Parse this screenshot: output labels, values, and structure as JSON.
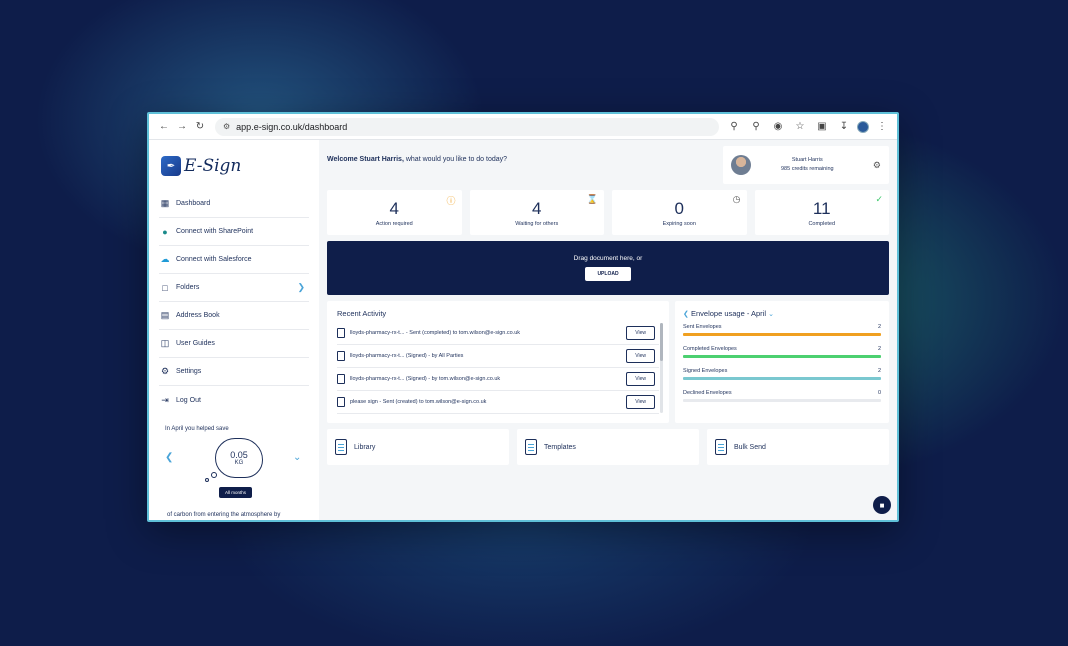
{
  "browser": {
    "url": "app.e-sign.co.uk/dashboard"
  },
  "logo": {
    "text": "E-Sign"
  },
  "sidebar": {
    "items": [
      {
        "label": "Dashboard",
        "icon": "dashboard-icon"
      },
      {
        "label": "Connect with SharePoint",
        "icon": "sharepoint-icon"
      },
      {
        "label": "Connect with Salesforce",
        "icon": "salesforce-icon"
      },
      {
        "label": "Folders",
        "icon": "folder-icon"
      },
      {
        "label": "Address Book",
        "icon": "address-book-icon"
      },
      {
        "label": "User Guides",
        "icon": "book-icon"
      },
      {
        "label": "Settings",
        "icon": "gear-icon"
      },
      {
        "label": "Log Out",
        "icon": "logout-icon"
      }
    ],
    "carbon": {
      "title": "In April you helped save",
      "value": "0.05",
      "unit": "KG",
      "button": "All months",
      "description": "of carbon from entering the atmosphere by utilising E-Sign"
    }
  },
  "welcome": {
    "name": "Welcome Stuart Harris,",
    "rest": " what would you like to do today?"
  },
  "user": {
    "name": "Stuart Harris",
    "credits": "985 credits remaining"
  },
  "stats": [
    {
      "value": "4",
      "label": "Action required",
      "icon_color": "#f0a020"
    },
    {
      "value": "4",
      "label": "Waiting for others",
      "icon_color": "#555555"
    },
    {
      "value": "0",
      "label": "Expiring soon",
      "icon_color": "#555555"
    },
    {
      "value": "11",
      "label": "Completed",
      "icon_color": "#3cc86a"
    }
  ],
  "upload": {
    "text": "Drag document here, or",
    "button": "UPLOAD"
  },
  "recent_activity": {
    "title": "Recent Activity",
    "view_label": "View",
    "rows": [
      "lloyds-pharmacy-rx-t... - Sent (completed) to tom.wilson@e-sign.co.uk",
      "lloyds-pharmacy-rx-t... (Signed) - by All Parties",
      "lloyds-pharmacy-rx-t... (Signed) - by tom.wilson@e-sign.co.uk",
      "please sign - Sent (created) to tom.wilson@e-sign.co.uk"
    ]
  },
  "envelope_usage": {
    "title": "Envelope usage - April",
    "rows": [
      {
        "label": "Sent Envelopes",
        "value": "2",
        "color": "#f0a020"
      },
      {
        "label": "Completed Envelopes",
        "value": "2",
        "color": "#4cd070"
      },
      {
        "label": "Signed Envelopes",
        "value": "2",
        "color": "#7ac8d0"
      },
      {
        "label": "Declined Envelopes",
        "value": "0",
        "color": "#e8eaee"
      }
    ]
  },
  "tiles": [
    {
      "label": "Library"
    },
    {
      "label": "Templates"
    },
    {
      "label": "Bulk Send"
    }
  ]
}
